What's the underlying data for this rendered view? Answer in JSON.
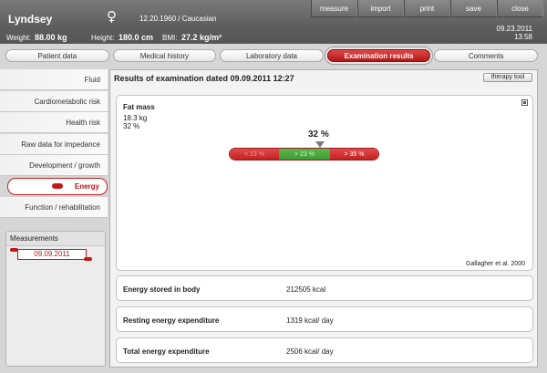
{
  "header": {
    "patient_name": "Lyndsey",
    "sex_symbol": "♀",
    "birth_info": "12.20.1960  /  Caucasian",
    "weight_label": "Weight:",
    "weight_value": "88.00 kg",
    "height_label": "Height:",
    "height_value": "180.0 cm",
    "bmi_label": "BMI:",
    "bmi_value": "27.2 kg/m²",
    "menu": [
      "measure",
      "import",
      "print",
      "save",
      "close"
    ],
    "date": "09.23.2011",
    "time": "13:58"
  },
  "tabs": [
    {
      "label": "Patient data",
      "active": false
    },
    {
      "label": "Medical history",
      "active": false
    },
    {
      "label": "Laboratory data",
      "active": false
    },
    {
      "label": "Examination results",
      "active": true
    },
    {
      "label": "Comments",
      "active": false
    }
  ],
  "sidebar": {
    "items": [
      {
        "label": "Fluid",
        "active": false
      },
      {
        "label": "Cardiometabolic risk",
        "active": false
      },
      {
        "label": "Health risk",
        "active": false
      },
      {
        "label": "Raw data for impedance",
        "active": false
      },
      {
        "label": "Development / growth",
        "active": false
      },
      {
        "label": "Energy",
        "active": true
      },
      {
        "label": "Function / rehabilitation",
        "active": false
      }
    ],
    "measurements_title": "Measurements",
    "measurement_entry": "09.09.2011"
  },
  "main": {
    "title": "Results of examination dated  09.09.2011  12:27",
    "therapy_button": "therapy tool",
    "parameter": {
      "name": "Fat mass",
      "kg": "18.3 kg",
      "percent": "32 %",
      "current_value": "32 %",
      "segments": [
        "< 23 %",
        "> 23 %",
        "> 35 %"
      ],
      "source": "Gallagher et al. 2000"
    },
    "results": [
      {
        "label": "Energy stored in body",
        "value": "212505 kcal"
      },
      {
        "label": "Resting energy expenditure",
        "value": "1319 kcal/ day"
      },
      {
        "label": "Total energy expenditure",
        "value": "2506 kcal/ day"
      }
    ]
  },
  "colors": {
    "accent_red": "#c21818",
    "range_green": "#4aa83f",
    "header_gray": "#666666"
  }
}
